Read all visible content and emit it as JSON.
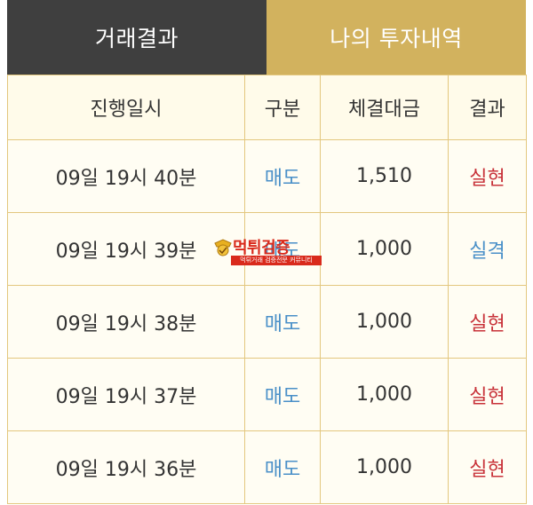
{
  "tabs": [
    {
      "label": "거래결과",
      "active": true
    },
    {
      "label": "나의 투자내역",
      "active": false
    }
  ],
  "table": {
    "headers": [
      "진행일시",
      "구분",
      "체결대금",
      "결과"
    ],
    "rows": [
      {
        "time": "09일 19시 40분",
        "type": "매도",
        "amount": "1,510",
        "result": "실현",
        "result_kind": "profit"
      },
      {
        "time": "09일 19시 39분",
        "type": "매도",
        "amount": "1,000",
        "result": "실격",
        "result_kind": "loss"
      },
      {
        "time": "09일 19시 38분",
        "type": "매도",
        "amount": "1,000",
        "result": "실현",
        "result_kind": "profit"
      },
      {
        "time": "09일 19시 37분",
        "type": "매도",
        "amount": "1,000",
        "result": "실현",
        "result_kind": "profit"
      },
      {
        "time": "09일 19시 36분",
        "type": "매도",
        "amount": "1,000",
        "result": "실현",
        "result_kind": "profit"
      }
    ]
  },
  "watermark": {
    "title": "먹튀검증",
    "subtitle": "먹튀거래 검증전문 커뮤니티",
    "icon": "badge-icon"
  },
  "colors": {
    "tab_active_bg": "#3f3f3f",
    "tab_inactive_bg": "#d2b25e",
    "border": "#e3c77e",
    "type_blue": "#4a90c8",
    "profit_red": "#c8333a"
  }
}
